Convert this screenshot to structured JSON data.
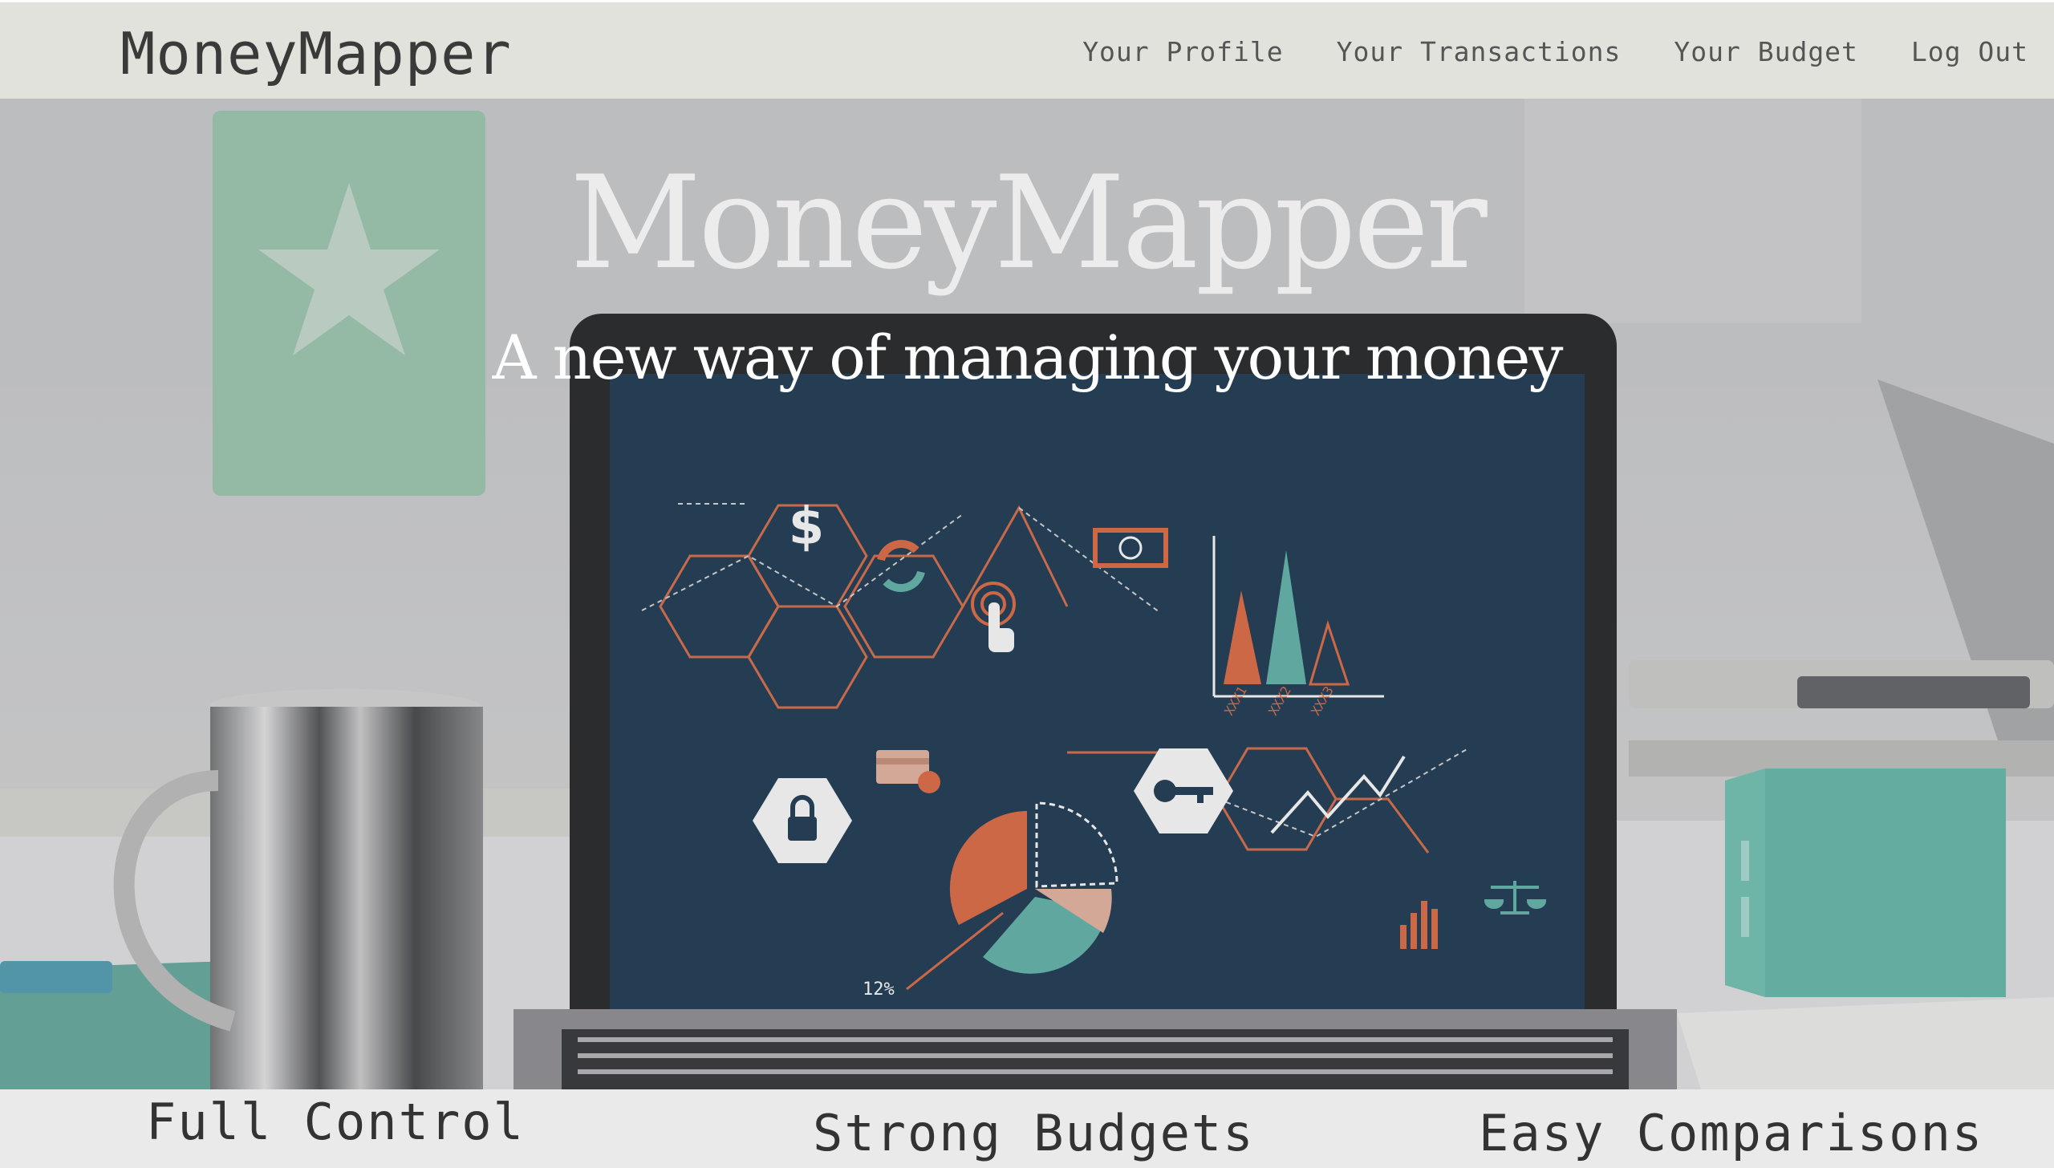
{
  "brand": "MoneyMapper",
  "nav": {
    "profile": "Your Profile",
    "transactions": "Your Transactions",
    "budget": "Your Budget",
    "logout": "Log Out"
  },
  "hero": {
    "title": "MoneyMapper",
    "subtitle": "A new way of managing your money",
    "screen_labels": {
      "dollar": "$",
      "percent": "12%",
      "bar1": "XXX1",
      "bar2": "XXX2",
      "bar3": "XXX3"
    }
  },
  "features": {
    "one": "Full Control",
    "two": "Strong Budgets",
    "three": "Easy Comparisons"
  },
  "colors": {
    "navbar": "#e2e2dc",
    "screen": "#12304a",
    "orange": "#e0643a",
    "teal": "#5bb3a6",
    "peach": "#e7b39c"
  }
}
